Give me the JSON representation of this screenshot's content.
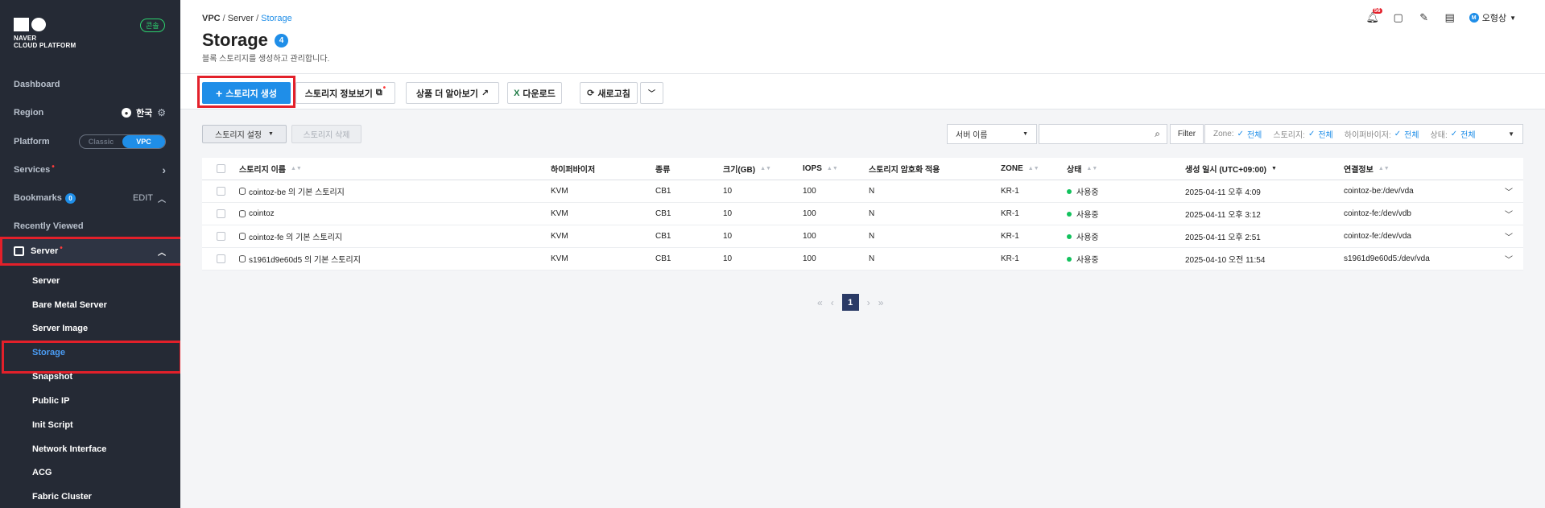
{
  "sidebar": {
    "logo_line1": "NAVER",
    "logo_line2": "CLOUD PLATFORM",
    "console_badge": "콘솔",
    "dashboard": "Dashboard",
    "region_label": "Region",
    "region_value": "한국",
    "platform_label": "Platform",
    "platform_options": [
      "Classic",
      "VPC"
    ],
    "platform_selected": "VPC",
    "services_label": "Services",
    "bookmarks_label": "Bookmarks",
    "bookmarks_count": "0",
    "bookmarks_edit": "EDIT",
    "recently_viewed": "Recently Viewed",
    "server_label": "Server",
    "sub_items": [
      "Server",
      "Bare Metal Server",
      "Server Image",
      "Storage",
      "Snapshot",
      "Public IP",
      "Init Script",
      "Network Interface",
      "ACG",
      "Fabric Cluster"
    ],
    "active_sub_item": "Storage"
  },
  "header": {
    "breadcrumb": [
      "VPC",
      "Server",
      "Storage"
    ],
    "title": "Storage",
    "count": "4",
    "description": "블록 스토리지를 생성하고 관리합니다.",
    "notification_count": "56",
    "user_initial": "M",
    "user_name": "오형상"
  },
  "toolbar": {
    "create": "스토리지 생성",
    "info": "스토리지 정보보기",
    "learn_more": "상품 더 알아보기",
    "download": "다운로드",
    "refresh": "새로고침"
  },
  "controls": {
    "settings": "스토리지 설정",
    "delete": "스토리지 삭제",
    "search_select": "서버 이름",
    "search_value": "",
    "filter": "Filter",
    "filters": [
      {
        "label": "Zone:",
        "value": "전체"
      },
      {
        "label": "스토리지:",
        "value": "전체"
      },
      {
        "label": "하이퍼바이저:",
        "value": "전체"
      },
      {
        "label": "상태:",
        "value": "전체"
      }
    ]
  },
  "table": {
    "columns": [
      "스토리지 이름",
      "하이퍼바이저",
      "종류",
      "크기(GB)",
      "IOPS",
      "스토리지 암호화 적용",
      "ZONE",
      "상태",
      "생성 일시 (UTC+09:00)",
      "연결정보"
    ],
    "rows": [
      {
        "name": "cointoz-be 의 기본 스토리지",
        "hypervisor": "KVM",
        "type": "CB1",
        "size": "10",
        "iops": "100",
        "encrypted": "N",
        "zone": "KR-1",
        "status": "사용중",
        "created": "2025-04-11 오후 4:09",
        "connection": "cointoz-be:/dev/vda"
      },
      {
        "name": "cointoz",
        "hypervisor": "KVM",
        "type": "CB1",
        "size": "10",
        "iops": "100",
        "encrypted": "N",
        "zone": "KR-1",
        "status": "사용중",
        "created": "2025-04-11 오후 3:12",
        "connection": "cointoz-fe:/dev/vdb"
      },
      {
        "name": "cointoz-fe 의 기본 스토리지",
        "hypervisor": "KVM",
        "type": "CB1",
        "size": "10",
        "iops": "100",
        "encrypted": "N",
        "zone": "KR-1",
        "status": "사용중",
        "created": "2025-04-11 오후 2:51",
        "connection": "cointoz-fe:/dev/vda"
      },
      {
        "name": "s1961d9e60d5 의 기본 스토리지",
        "hypervisor": "KVM",
        "type": "CB1",
        "size": "10",
        "iops": "100",
        "encrypted": "N",
        "zone": "KR-1",
        "status": "사용중",
        "created": "2025-04-10 오전 11:54",
        "connection": "s1961d9e60d5:/dev/vda"
      }
    ]
  },
  "pagination": {
    "current": "1"
  },
  "colors": {
    "accent": "#1f8ee8",
    "highlight": "#e3202a",
    "sidebar_bg": "#252a35",
    "status_ok": "#12c25d"
  }
}
